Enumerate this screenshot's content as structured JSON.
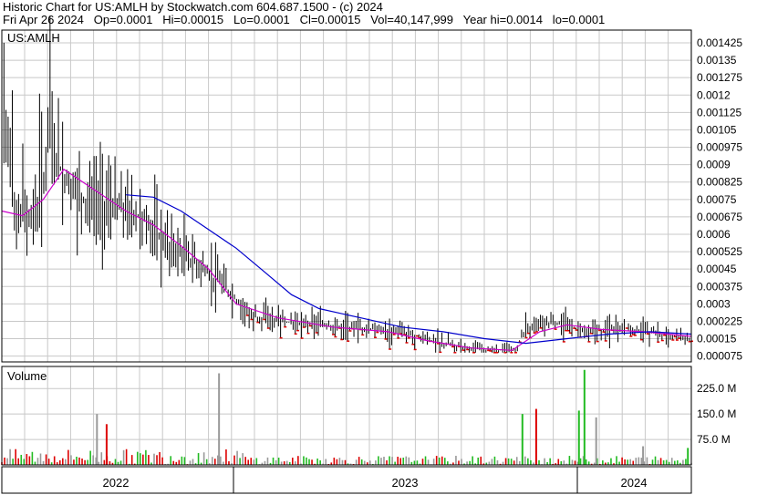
{
  "header": {
    "line1": "Historic Chart for US:AMLH by Stockwatch.com 604.687.1500 - (c) 2024",
    "line2": "Fri Apr 26 2024   Op=0.0001   Hi=0.00015   Lo=0.0001   Cl=0.00015   Vol=40,147,999   Year hi=0.0014   lo=0.0001"
  },
  "colors": {
    "bar": "#000000",
    "ma_short": "#cc00cc",
    "ma_long": "#0000cc",
    "vol_up": "#22bb22",
    "vol_down": "#dd0000",
    "vol_flat": "#999999",
    "grid": "#c8c8c8",
    "low_marker": "#dd0000"
  },
  "chart_data": [
    {
      "type": "line",
      "title": "US:AMLH",
      "ylim": [
        5e-05,
        0.00148
      ],
      "y_ticks": [
        "0.001425",
        "0.00135",
        "0.001275",
        "0.0012",
        "0.001125",
        "0.00105",
        "0.000975",
        "0.0009",
        "0.000825",
        "0.00075",
        "0.000675",
        "0.0006",
        "0.000525",
        "0.00045",
        "0.000375",
        "0.0003",
        "0.000225",
        "0.00015",
        "0.000075"
      ],
      "x_ticks": [
        "2022",
        "2023",
        "2024"
      ],
      "x_period": {
        "start": "2022-01",
        "end": "2024-04"
      },
      "series": [
        {
          "role": "price",
          "description_points": [
            {
              "t": 0.0,
              "y": 0.00085
            },
            {
              "t": 0.01,
              "y": 0.0011
            },
            {
              "t": 0.02,
              "y": 0.00065
            },
            {
              "t": 0.05,
              "y": 0.0007
            },
            {
              "t": 0.07,
              "y": 0.001
            },
            {
              "t": 0.09,
              "y": 0.00085
            },
            {
              "t": 0.12,
              "y": 0.00075
            },
            {
              "t": 0.16,
              "y": 0.00072
            },
            {
              "t": 0.2,
              "y": 0.00068
            },
            {
              "t": 0.24,
              "y": 0.00055
            },
            {
              "t": 0.28,
              "y": 0.00048
            },
            {
              "t": 0.32,
              "y": 0.00038
            },
            {
              "t": 0.36,
              "y": 0.00025
            },
            {
              "t": 0.42,
              "y": 0.00022
            },
            {
              "t": 0.5,
              "y": 0.0002
            },
            {
              "t": 0.58,
              "y": 0.00018
            },
            {
              "t": 0.64,
              "y": 0.00013
            },
            {
              "t": 0.7,
              "y": 0.0001
            },
            {
              "t": 0.745,
              "y": 0.0001
            },
            {
              "t": 0.76,
              "y": 0.0002
            },
            {
              "t": 0.8,
              "y": 0.00022
            },
            {
              "t": 0.85,
              "y": 0.00018
            },
            {
              "t": 0.9,
              "y": 0.0002
            },
            {
              "t": 0.95,
              "y": 0.00017
            },
            {
              "t": 1.0,
              "y": 0.00015
            }
          ]
        },
        {
          "role": "ma_short",
          "points": [
            {
              "t": 0.0,
              "y": 0.0007
            },
            {
              "t": 0.03,
              "y": 0.00068
            },
            {
              "t": 0.06,
              "y": 0.00075
            },
            {
              "t": 0.09,
              "y": 0.00088
            },
            {
              "t": 0.13,
              "y": 0.0008
            },
            {
              "t": 0.18,
              "y": 0.0007
            },
            {
              "t": 0.22,
              "y": 0.00064
            },
            {
              "t": 0.26,
              "y": 0.00055
            },
            {
              "t": 0.3,
              "y": 0.00045
            },
            {
              "t": 0.34,
              "y": 0.0003
            },
            {
              "t": 0.4,
              "y": 0.00024
            },
            {
              "t": 0.48,
              "y": 0.0002
            },
            {
              "t": 0.56,
              "y": 0.00018
            },
            {
              "t": 0.62,
              "y": 0.00014
            },
            {
              "t": 0.68,
              "y": 0.00011
            },
            {
              "t": 0.74,
              "y": 0.0001
            },
            {
              "t": 0.78,
              "y": 0.00018
            },
            {
              "t": 0.82,
              "y": 0.00021
            },
            {
              "t": 0.87,
              "y": 0.00019
            },
            {
              "t": 0.93,
              "y": 0.00018
            },
            {
              "t": 1.0,
              "y": 0.00016
            }
          ]
        },
        {
          "role": "ma_long",
          "points": [
            {
              "t": 0.18,
              "y": 0.00077
            },
            {
              "t": 0.22,
              "y": 0.00076
            },
            {
              "t": 0.26,
              "y": 0.0007
            },
            {
              "t": 0.3,
              "y": 0.00062
            },
            {
              "t": 0.34,
              "y": 0.00054
            },
            {
              "t": 0.38,
              "y": 0.00044
            },
            {
              "t": 0.42,
              "y": 0.00034
            },
            {
              "t": 0.46,
              "y": 0.00028
            },
            {
              "t": 0.52,
              "y": 0.00024
            },
            {
              "t": 0.58,
              "y": 0.0002
            },
            {
              "t": 0.64,
              "y": 0.00018
            },
            {
              "t": 0.7,
              "y": 0.00015
            },
            {
              "t": 0.76,
              "y": 0.00013
            },
            {
              "t": 0.82,
              "y": 0.00015
            },
            {
              "t": 0.88,
              "y": 0.00017
            },
            {
              "t": 0.94,
              "y": 0.00018
            },
            {
              "t": 1.0,
              "y": 0.00017
            }
          ]
        }
      ]
    },
    {
      "type": "bar",
      "title": "Volume",
      "ylim": [
        0,
        290000000
      ],
      "y_ticks": [
        {
          "label": "225.0 M",
          "value": 225000000
        },
        {
          "label": "150.0 M",
          "value": 150000000
        },
        {
          "label": "75.0 M",
          "value": 75000000
        }
      ],
      "spikes": [
        {
          "t": 0.315,
          "value": 270000000,
          "dir": "flat"
        },
        {
          "t": 0.138,
          "value": 150000000,
          "dir": "flat"
        },
        {
          "t": 0.152,
          "value": 120000000,
          "dir": "down"
        },
        {
          "t": 0.775,
          "value": 165000000,
          "dir": "down"
        },
        {
          "t": 0.755,
          "value": 150000000,
          "dir": "up"
        },
        {
          "t": 0.845,
          "value": 280000000,
          "dir": "up"
        },
        {
          "t": 0.837,
          "value": 160000000,
          "dir": "up"
        },
        {
          "t": 0.862,
          "value": 140000000,
          "dir": "flat"
        },
        {
          "t": 0.93,
          "value": 55000000,
          "dir": "flat"
        },
        {
          "t": 0.995,
          "value": 50000000,
          "dir": "up"
        }
      ]
    }
  ]
}
